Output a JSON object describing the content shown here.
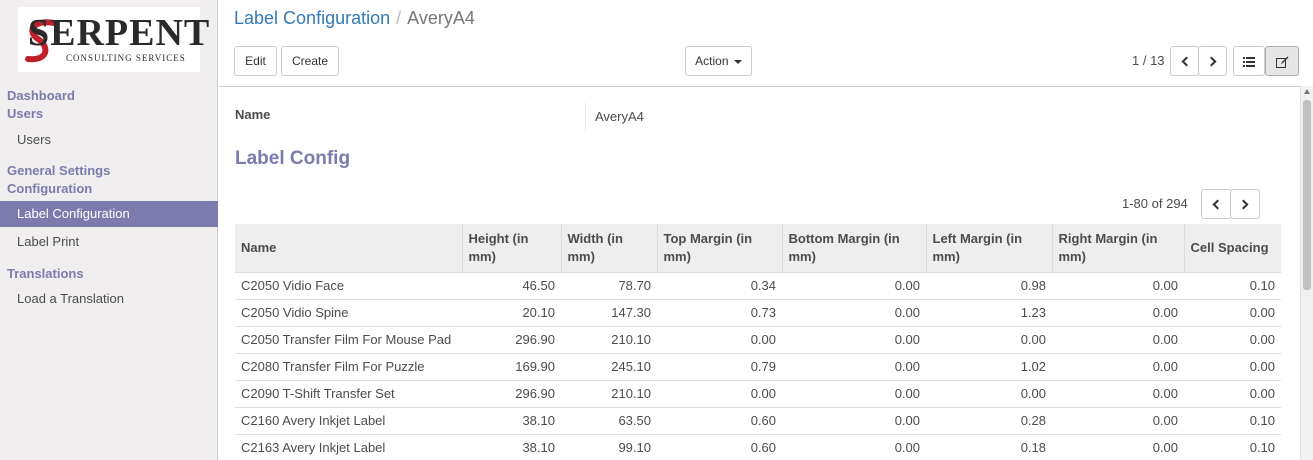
{
  "logo": {
    "main": "SERPENT",
    "sub": "CONSULTING SERVICES"
  },
  "sidebar": {
    "groups": [
      {
        "heading": "Dashboard"
      },
      {
        "heading": "Users",
        "items": [
          "Users"
        ]
      },
      {
        "heading": "General Settings"
      },
      {
        "heading": "Configuration",
        "items": [
          "Label Configuration",
          "Label Print"
        ]
      },
      {
        "heading": "Translations",
        "items": [
          "Load a Translation"
        ]
      }
    ],
    "active_item": "Label Configuration"
  },
  "breadcrumb": {
    "parent": "Label Configuration",
    "separator": "/",
    "current": "AveryA4"
  },
  "toolbar": {
    "edit_label": "Edit",
    "create_label": "Create",
    "action_label": "Action"
  },
  "pager": {
    "text": "1 / 13"
  },
  "form": {
    "name_label": "Name",
    "name_value": "AveryA4",
    "section_title": "Label Config",
    "list_pager": "1-80 of 294"
  },
  "table": {
    "columns": [
      "Name",
      "Height (in mm)",
      "Width (in mm)",
      "Top Margin (in mm)",
      "Bottom Margin (in mm)",
      "Left Margin (in mm)",
      "Right Margin (in mm)",
      "Cell Spacing"
    ],
    "rows": [
      [
        "C2050 Vidio Face",
        "46.50",
        "78.70",
        "0.34",
        "0.00",
        "0.98",
        "0.00",
        "0.10"
      ],
      [
        "C2050 Vidio Spine",
        "20.10",
        "147.30",
        "0.73",
        "0.00",
        "1.23",
        "0.00",
        "0.00"
      ],
      [
        "C2050 Transfer Film For Mouse Pad",
        "296.90",
        "210.10",
        "0.00",
        "0.00",
        "0.00",
        "0.00",
        "0.00"
      ],
      [
        "C2080 Transfer Film For Puzzle",
        "169.90",
        "245.10",
        "0.79",
        "0.00",
        "1.02",
        "0.00",
        "0.00"
      ],
      [
        "C2090 T-Shift Transfer Set",
        "296.90",
        "210.10",
        "0.00",
        "0.00",
        "0.00",
        "0.00",
        "0.00"
      ],
      [
        "C2160 Avery Inkjet Label",
        "38.10",
        "63.50",
        "0.60",
        "0.00",
        "0.28",
        "0.00",
        "0.10"
      ],
      [
        "C2163 Avery Inkjet Label",
        "38.10",
        "99.10",
        "0.60",
        "0.00",
        "0.18",
        "0.00",
        "0.10"
      ]
    ]
  },
  "colors": {
    "accent": "#7c7bad",
    "link": "#337ab7",
    "logo_red": "#c0202a"
  },
  "icons": [
    "chevron-left-icon",
    "chevron-right-icon",
    "list-view-icon",
    "form-view-icon",
    "caret-down-icon"
  ]
}
